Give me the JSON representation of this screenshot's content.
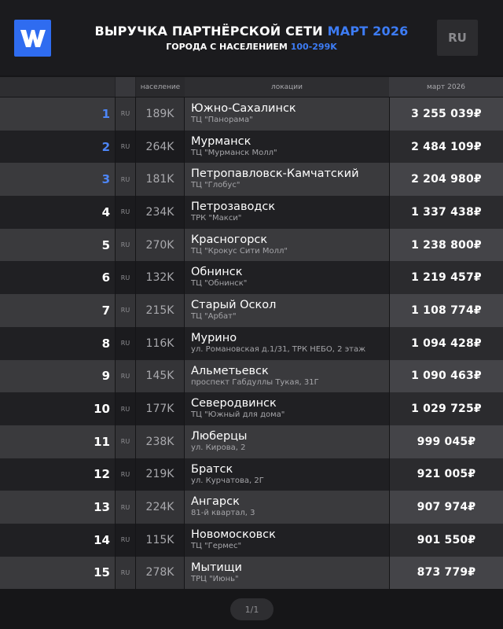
{
  "header": {
    "logo_icon": "w-logo-icon",
    "title_main": "ВЫРУЧКА ПАРТНЁРСКОЙ СЕТИ",
    "title_accent": "МАРТ 2026",
    "subtitle_main": "ГОРОДА С НАСЕЛЕНИЕМ",
    "subtitle_accent": "100-299K",
    "lang_button": "RU",
    "accent_color": "#3d7cf5"
  },
  "table": {
    "headers": {
      "population": "население",
      "locations": "локации",
      "revenue": "март 2026"
    },
    "rows": [
      {
        "rank": "1",
        "cc": "RU",
        "pop": "189K",
        "city": "Южно-Сахалинск",
        "place": "ТЦ \"Панорама\"",
        "rev": "3 255 039₽"
      },
      {
        "rank": "2",
        "cc": "RU",
        "pop": "264K",
        "city": "Мурманск",
        "place": "ТЦ \"Мурманск Молл\"",
        "rev": "2 484 109₽"
      },
      {
        "rank": "3",
        "cc": "RU",
        "pop": "181K",
        "city": "Петропавловск-Камчатский",
        "place": "ТЦ \"Глобус\"",
        "rev": "2 204 980₽"
      },
      {
        "rank": "4",
        "cc": "RU",
        "pop": "234K",
        "city": "Петрозаводск",
        "place": "ТРК \"Макси\"",
        "rev": "1 337 438₽"
      },
      {
        "rank": "5",
        "cc": "RU",
        "pop": "270K",
        "city": "Красногорск",
        "place": "ТЦ \"Крокус Сити Молл\"",
        "rev": "1 238 800₽"
      },
      {
        "rank": "6",
        "cc": "RU",
        "pop": "132K",
        "city": "Обнинск",
        "place": "ТЦ \"Обнинск\"",
        "rev": "1 219 457₽"
      },
      {
        "rank": "7",
        "cc": "RU",
        "pop": "215K",
        "city": "Старый Оскол",
        "place": "ТЦ \"Арбат\"",
        "rev": "1 108 774₽"
      },
      {
        "rank": "8",
        "cc": "RU",
        "pop": "116K",
        "city": "Мурино",
        "place": "ул. Романовская д.1/31, ТРК НЕБО, 2 этаж",
        "rev": "1 094 428₽"
      },
      {
        "rank": "9",
        "cc": "RU",
        "pop": "145K",
        "city": "Альметьевск",
        "place": "проспект Габдуллы Тукая, 31Г",
        "rev": "1 090 463₽"
      },
      {
        "rank": "10",
        "cc": "RU",
        "pop": "177K",
        "city": "Северодвинск",
        "place": "ТЦ \"Южный для дома\"",
        "rev": "1 029 725₽"
      },
      {
        "rank": "11",
        "cc": "RU",
        "pop": "238K",
        "city": "Люберцы",
        "place": "ул. Кирова, 2",
        "rev": "999 045₽"
      },
      {
        "rank": "12",
        "cc": "RU",
        "pop": "219K",
        "city": "Братск",
        "place": "ул. Курчатова, 2Г",
        "rev": "921 005₽"
      },
      {
        "rank": "13",
        "cc": "RU",
        "pop": "224K",
        "city": "Ангарск",
        "place": "81-й квартал, 3",
        "rev": "907 974₽"
      },
      {
        "rank": "14",
        "cc": "RU",
        "pop": "115K",
        "city": "Новомосковск",
        "place": "ТЦ \"Гермес\"",
        "rev": "901 550₽"
      },
      {
        "rank": "15",
        "cc": "RU",
        "pop": "278K",
        "city": "Мытищи",
        "place": "ТРЦ \"Июнь\"",
        "rev": "873 779₽"
      }
    ]
  },
  "pager": {
    "label": "1/1"
  }
}
